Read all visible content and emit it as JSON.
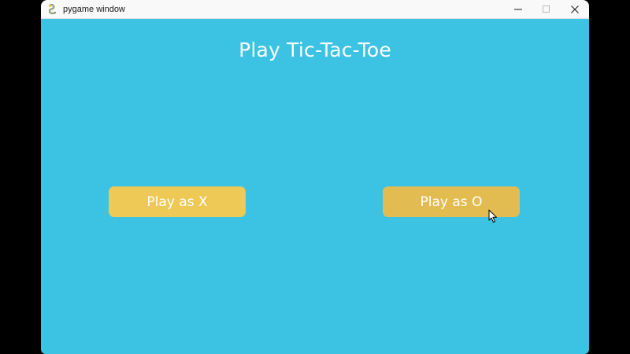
{
  "window": {
    "title": "pygame window",
    "app_icon": "pygame-snake-icon",
    "controls": {
      "minimize_icon": "minimize-icon",
      "maximize_icon": "maximize-icon",
      "close_icon": "close-icon"
    }
  },
  "screen": {
    "heading": "Play Tic-Tac-Toe",
    "background_color": "#3CC3E3",
    "buttons": {
      "play_x": "Play as X",
      "play_o": "Play as O"
    },
    "button_color": "#EEC955",
    "button_hover_color": "#E3BC51",
    "text_color": "#FFFFFF"
  }
}
